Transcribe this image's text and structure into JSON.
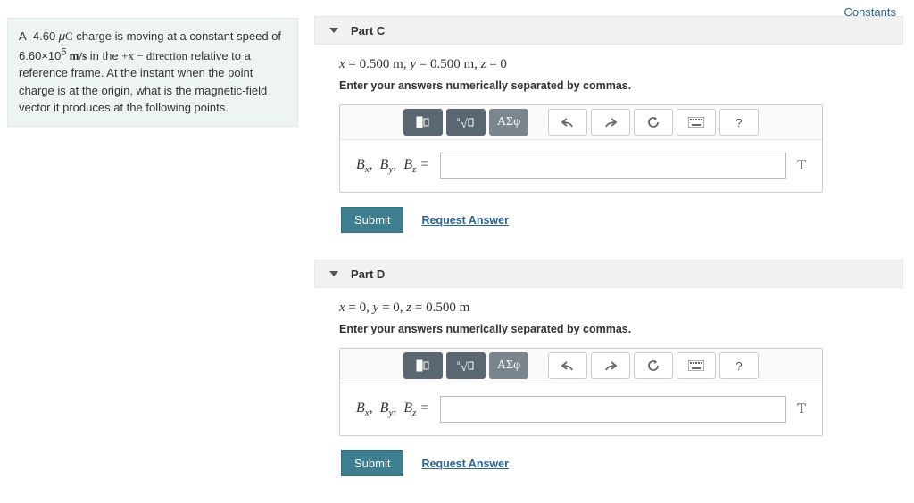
{
  "constants_link": "Constants",
  "problem": {
    "text_before_charge": "A -4.60 ",
    "micro": "μ",
    "coulomb": "C",
    "text_after_charge": " charge is moving at a constant speed of 6.60×10",
    "exp": "5",
    "speed_unit": " m/s",
    "text_dir1": " in the ",
    "plus_x": "+x − direction",
    "text_rest": " relative to a reference frame. At the instant when the point charge is at the origin, what is the magnetic-field vector it produces at the following points."
  },
  "parts": [
    {
      "title": "Part C",
      "equation_html": "x = 0.500 m, y = 0.500 m, z = 0",
      "instruction": "Enter your answers numerically separated by commas.",
      "var_label": "Bₓ,  B_y,  B_z  =",
      "unit": "T",
      "submit": "Submit",
      "request": "Request Answer"
    },
    {
      "title": "Part D",
      "equation_html": "x = 0, y = 0, z = 0.500 m",
      "instruction": "Enter your answers numerically separated by commas.",
      "var_label": "Bₓ,  B_y,  B_z  =",
      "unit": "T",
      "submit": "Submit",
      "request": "Request Answer"
    }
  ],
  "toolbar": {
    "sqrt_btn": "ⁿ√x",
    "greek_btn": "ΑΣφ",
    "help": "?"
  }
}
